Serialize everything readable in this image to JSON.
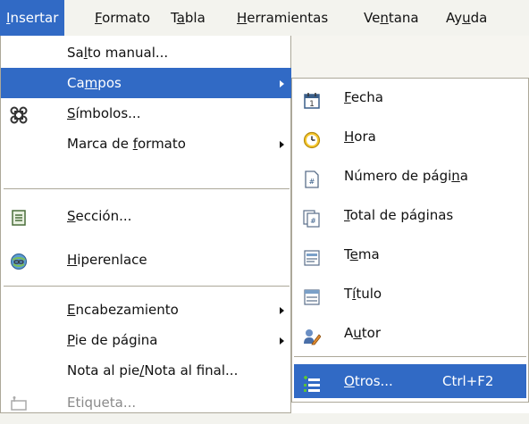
{
  "menubar": {
    "items": [
      {
        "pre": "",
        "u": "I",
        "post": "nsertar"
      },
      {
        "pre": "",
        "u": "F",
        "post": "ormato"
      },
      {
        "pre": "T",
        "u": "a",
        "post": "bla"
      },
      {
        "pre": "",
        "u": "H",
        "post": "erramientas"
      },
      {
        "pre": "Ve",
        "u": "n",
        "post": "tana"
      },
      {
        "pre": "Ay",
        "u": "u",
        "post": "da"
      }
    ]
  },
  "menu": {
    "salto": {
      "pre": "Sa",
      "u": "l",
      "post": "to manual..."
    },
    "campos": {
      "pre": "Ca",
      "u": "m",
      "post": "pos"
    },
    "simbolos": {
      "pre": "",
      "u": "S",
      "post": "ímbolos..."
    },
    "marca": {
      "pre": "Marca de ",
      "u": "f",
      "post": "ormato"
    },
    "seccion": {
      "pre": "",
      "u": "S",
      "post": "ección..."
    },
    "hiperenlace": {
      "pre": "",
      "u": "H",
      "post": "iperenlace"
    },
    "encabezamiento": {
      "pre": "",
      "u": "E",
      "post": "ncabezamiento"
    },
    "pie": {
      "pre": "",
      "u": "P",
      "post": "ie de página"
    },
    "nota": {
      "pre": "Nota al pie",
      "u": "/",
      "post": "Nota al final..."
    },
    "etiqueta": {
      "pre": "Etiqueta..."
    }
  },
  "submenu": {
    "fecha": {
      "pre": "",
      "u": "F",
      "post": "echa"
    },
    "hora": {
      "pre": "",
      "u": "H",
      "post": "ora"
    },
    "numero": {
      "pre": "Número de pági",
      "u": "n",
      "post": "a"
    },
    "total": {
      "pre": "",
      "u": "T",
      "post": "otal de páginas"
    },
    "tema": {
      "pre": "T",
      "u": "e",
      "post": "ma"
    },
    "titulo": {
      "pre": "T",
      "u": "í",
      "post": "tulo"
    },
    "autor": {
      "pre": "A",
      "u": "u",
      "post": "tor"
    },
    "otros": {
      "pre": "",
      "u": "O",
      "post": "tros...",
      "shortcut": "Ctrl+F2"
    }
  },
  "colors": {
    "highlight": "#316ac5",
    "menu_bg": "#ffffff",
    "bar_bg": "#f3f3ee"
  },
  "icons": [
    "symbols-icon",
    "section-icon",
    "hyperlink-icon",
    "label-icon",
    "calendar-icon",
    "clock-icon",
    "page-number-icon",
    "total-pages-icon",
    "subject-icon",
    "title-icon",
    "author-icon",
    "other-fields-icon",
    "arrow-right-icon"
  ]
}
